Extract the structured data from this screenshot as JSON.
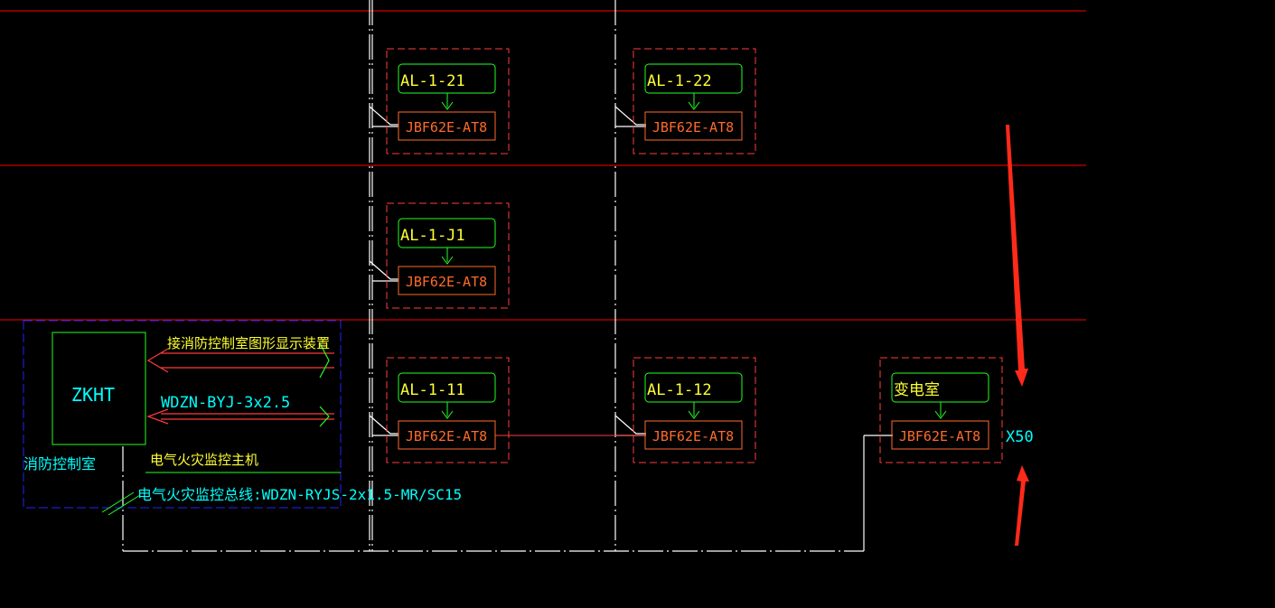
{
  "colors": {
    "background": "#000000",
    "grid_red": "#ff0000",
    "box_border": "#ff3b3b",
    "label_border": "#22ff22",
    "label_text": "#ffff33",
    "device_border": "#ff6a2a",
    "device_text": "#ff6a2a",
    "wire": "#ffffff",
    "cyan": "#00ffff",
    "blue_dash": "#2222ff",
    "annotation_arrow": "#ff2a1a"
  },
  "panels": [
    {
      "label": "AL-1-21",
      "device": "JBF62E-AT8"
    },
    {
      "label": "AL-1-22",
      "device": "JBF62E-AT8"
    },
    {
      "label": "AL-1-J1",
      "device": "JBF62E-AT8"
    },
    {
      "label": "AL-1-11",
      "device": "JBF62E-AT8"
    },
    {
      "label": "AL-1-12",
      "device": "JBF62E-AT8"
    },
    {
      "label": "变电室",
      "device": "JBF62E-AT8"
    }
  ],
  "control_room": {
    "host_label": "ZKHT",
    "room_label": "消防控制室",
    "display_link_label": "接消防控制室图形显示装置",
    "power_cable_label": "WDZN-BYJ-3x2.5",
    "host_caption": "电气火灾监控主机",
    "bus_label": "电气火灾监控总线:WDZN-RYJS-2x1.5-MR/SC15"
  },
  "scale_note": "X50",
  "icons": {
    "green_arrow": "arrow-down-icon",
    "double_arrow": "double-arrow-left-icon",
    "red_pointer": "annotation-arrow-icon"
  }
}
